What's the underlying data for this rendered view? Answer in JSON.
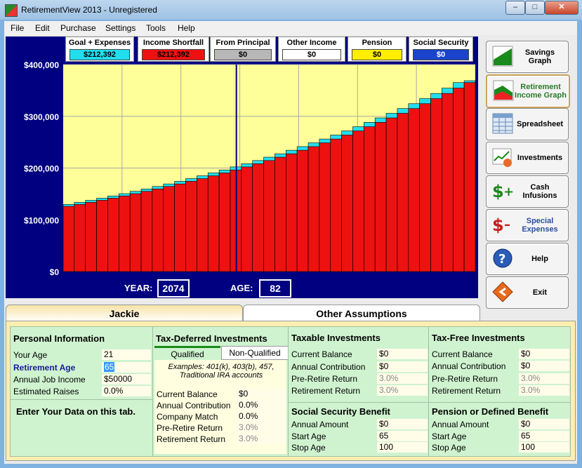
{
  "window": {
    "title": "RetirementView 2013 - Unregistered"
  },
  "menu": [
    "File",
    "Edit",
    "Purchase",
    "Settings",
    "Tools",
    "Help"
  ],
  "legend": [
    {
      "title": "Goal + Expenses",
      "value": "$212,392",
      "color": "#22ddee"
    },
    {
      "title": "Income Shortfall",
      "value": "$212,392",
      "color": "#ee1111"
    },
    {
      "title": "From Principal",
      "value": "$0",
      "color": "#b8b8b8"
    },
    {
      "title": "Other Income",
      "value": "$0",
      "color": "#ffffff"
    },
    {
      "title": "Pension",
      "value": "$0",
      "color": "#ffee00"
    },
    {
      "title": "Social Security",
      "value": "$0",
      "color": "#1a44cc"
    }
  ],
  "chart_data": {
    "type": "bar",
    "ylim": [
      0,
      400000
    ],
    "yticks": [
      "$0",
      "$100,000",
      "$200,000",
      "$300,000",
      "$400,000"
    ],
    "ytick_values": [
      0,
      100000,
      200000,
      300000,
      400000
    ],
    "series": [
      {
        "name": "Income Shortfall",
        "color": "#ee1111",
        "values": [
          126000,
          129800,
          133700,
          137700,
          141800,
          146100,
          150500,
          155000,
          159600,
          164400,
          169300,
          174400,
          179600,
          185000,
          190600,
          196300,
          202200,
          208300,
          214500,
          221000,
          227600,
          234400,
          241400,
          248700,
          256100,
          263800,
          271700,
          279900,
          288300,
          296900,
          305800,
          315000,
          324400,
          334200,
          344200,
          354500,
          365200
        ]
      },
      {
        "name": "Goal + Expenses",
        "color": "#22ddee",
        "values": [
          129800,
          133700,
          137700,
          141800,
          146100,
          150500,
          155000,
          159600,
          164400,
          169300,
          174400,
          179600,
          185000,
          190600,
          196300,
          202200,
          208300,
          214500,
          221000,
          227600,
          234400,
          241400,
          248700,
          256100,
          263800,
          271700,
          279900,
          288300,
          296900,
          305800,
          315000,
          324400,
          334200,
          344200,
          354500,
          365200,
          368800
        ]
      }
    ],
    "marker_bar_index": 15
  },
  "readout": {
    "year_label": "YEAR:",
    "year": "2074",
    "age_label": "AGE:",
    "age": "82"
  },
  "side_buttons": [
    {
      "label": "Savings Graph",
      "icon": "savings-graph-icon"
    },
    {
      "label": "Retirement Income Graph",
      "icon": "retirement-income-graph-icon"
    },
    {
      "label": "Spreadsheet",
      "icon": "spreadsheet-icon"
    },
    {
      "label": "Investments",
      "icon": "investments-icon"
    },
    {
      "label": "Cash Infusions",
      "icon": "cash-infusions-icon"
    },
    {
      "label": "Special Expenses",
      "icon": "special-expenses-icon"
    },
    {
      "label": "Help",
      "icon": "help-icon"
    },
    {
      "label": "Exit",
      "icon": "exit-icon"
    }
  ],
  "tabs": {
    "jackie": "Jackie",
    "other": "Other Assumptions"
  },
  "personal": {
    "title": "Personal Information",
    "your_age_label": "Your Age",
    "your_age": "21",
    "ret_age_label": "Retirement Age",
    "ret_age": "65",
    "income_label": "Annual Job Income",
    "income": "$50000",
    "raises_label": "Estimated Raises",
    "raises": "0.0%",
    "hint": "Enter Your Data on this tab."
  },
  "taxdef": {
    "title": "Tax-Deferred Investments",
    "tab_q": "Qualified",
    "tab_nq": "Non-Qualified",
    "examples": "Examples: 401(k), 403(b), 457, Traditional IRA accounts",
    "bal_label": "Current Balance",
    "bal": "$0",
    "contrib_label": "Annual Contribution",
    "contrib": "0.0%",
    "match_label": "Company Match",
    "match": "0.0%",
    "pre_label": "Pre-Retire Return",
    "pre": "3.0%",
    "ret_label": "Retirement Return",
    "ret": "3.0%"
  },
  "taxable": {
    "title": "Taxable Investments",
    "bal_label": "Current Balance",
    "bal": "$0",
    "contrib_label": "Annual Contribution",
    "contrib": "$0",
    "pre_label": "Pre-Retire Return",
    "pre": "3.0%",
    "ret_label": "Retirement Return",
    "ret": "3.0%"
  },
  "taxfree": {
    "title": "Tax-Free Investments",
    "bal_label": "Current Balance",
    "bal": "$0",
    "contrib_label": "Annual Contribution",
    "contrib": "$0",
    "pre_label": "Pre-Retire Return",
    "pre": "3.0%",
    "ret_label": "Retirement Return",
    "ret": "3.0%"
  },
  "ss": {
    "title": "Social Security Benefit",
    "amt_label": "Annual Amount",
    "amt": "$0",
    "start_label": "Start Age",
    "start": "65",
    "stop_label": "Stop Age",
    "stop": "100"
  },
  "pension": {
    "title": "Pension or Defined Benefit",
    "amt_label": "Annual Amount",
    "amt": "$0",
    "start_label": "Start Age",
    "start": "65",
    "stop_label": "Stop Age",
    "stop": "100"
  }
}
